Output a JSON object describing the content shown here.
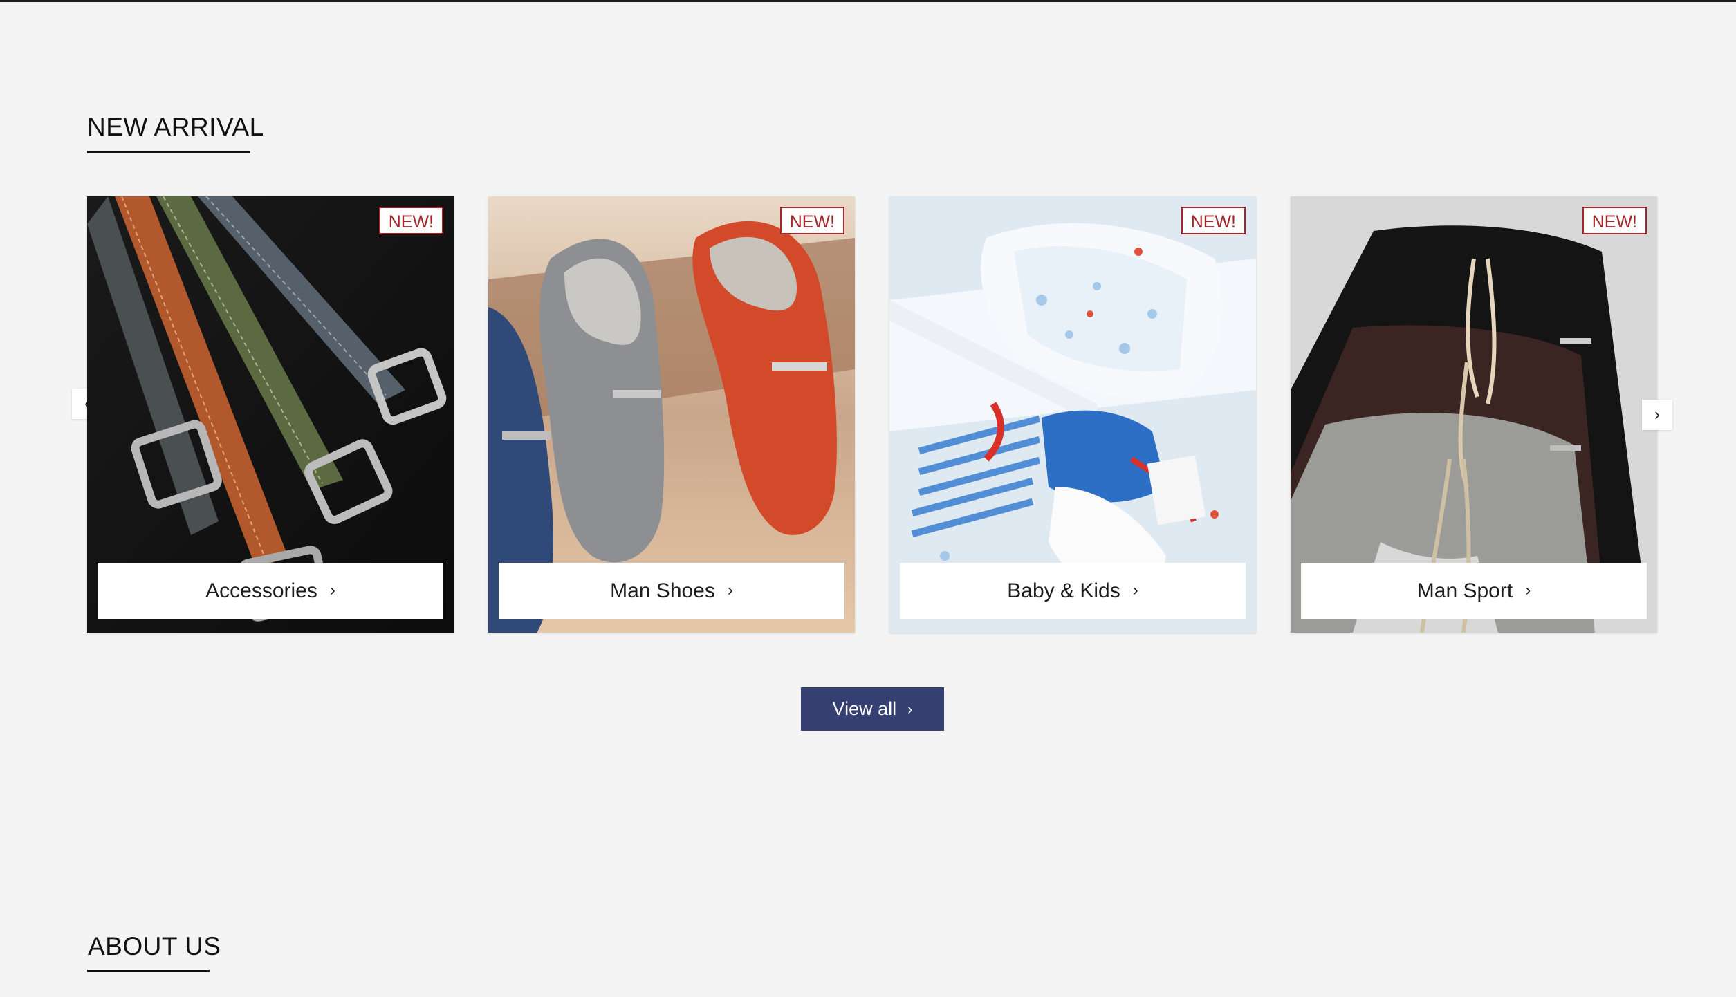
{
  "new_arrival": {
    "heading": "NEW ARRIVAL",
    "cards": [
      {
        "label": "Accessories",
        "badge": "NEW!",
        "chevron": "›"
      },
      {
        "label": "Man Shoes",
        "badge": "NEW!",
        "chevron": "›"
      },
      {
        "label": "Baby & Kids",
        "badge": "NEW!",
        "chevron": "›"
      },
      {
        "label": "Man Sport",
        "badge": "NEW!",
        "chevron": "›"
      }
    ],
    "prev_icon": "‹",
    "next_icon": "›",
    "view_all": {
      "label": "View all",
      "chevron": "›"
    }
  },
  "about": {
    "heading": "ABOUT US"
  },
  "colors": {
    "background": "#f4f4f4",
    "badge": "#a3262a",
    "view_all_button": "#363f72"
  }
}
